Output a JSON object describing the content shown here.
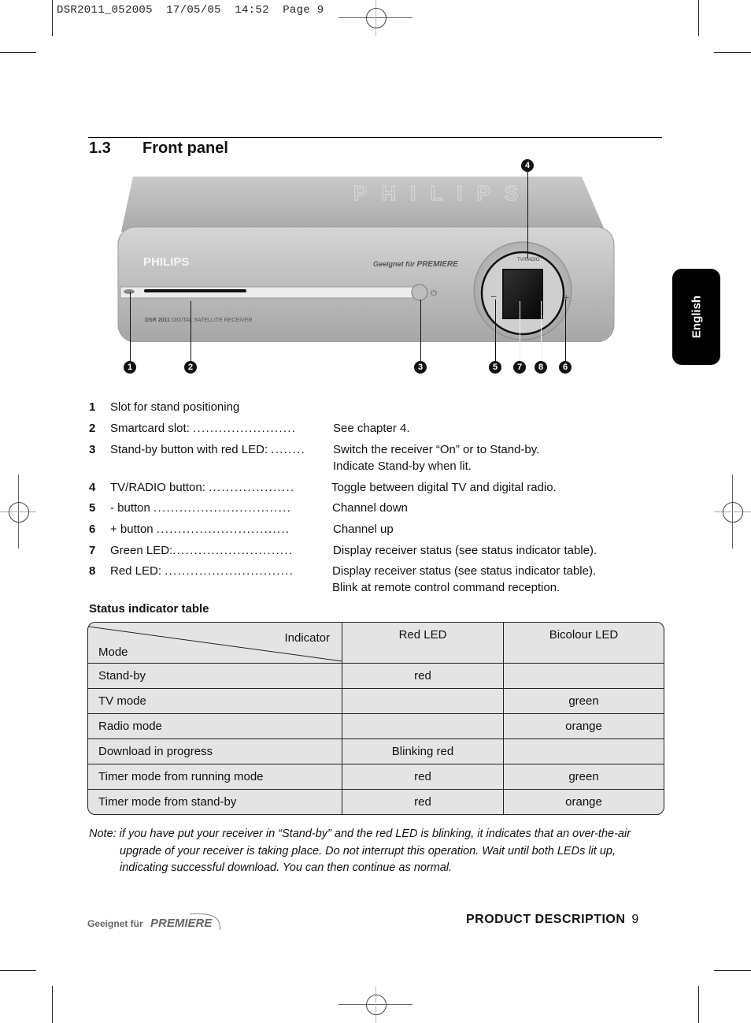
{
  "slug": {
    "file": "DSR2011_052005",
    "date": "17/05/05",
    "time": "14:52",
    "page_label": "Page",
    "page_num": "9"
  },
  "section": {
    "number": "1.3",
    "title": "Front panel"
  },
  "language_tab": "English",
  "device": {
    "brand": "PHILIPS",
    "badge_prefix": "Geeignet für",
    "badge_brand": "PREMIERE",
    "model": "DSR 2011",
    "model_desc": "DIGITAL SATELLITE RECEIVER",
    "tv_radio_label": "TV/RADIO",
    "minus_label": "−",
    "plus_label": "+",
    "callouts": [
      "1",
      "2",
      "3",
      "4",
      "5",
      "6",
      "7",
      "8"
    ]
  },
  "items": [
    {
      "num": "1",
      "label": "Slot for stand positioning",
      "leader": "",
      "desc": [
        ""
      ]
    },
    {
      "num": "2",
      "label": "Smartcard slot:",
      "leader": "........................",
      "desc": [
        "See chapter 4."
      ]
    },
    {
      "num": "3",
      "label": "Stand-by button with red LED:",
      "leader": "........",
      "desc": [
        "Switch the receiver “On” or to Stand-by.",
        "Indicate Stand-by when lit."
      ]
    },
    {
      "num": "4",
      "label": "TV/RADIO button:",
      "leader": "....................",
      "desc": [
        "Toggle between digital TV and digital radio."
      ]
    },
    {
      "num": "5",
      "label": "- button",
      "leader": "................................",
      "desc": [
        "Channel down"
      ]
    },
    {
      "num": "6",
      "label": "+ button",
      "leader": "...............................",
      "desc": [
        "Channel up"
      ]
    },
    {
      "num": "7",
      "label": "Green LED:",
      "leader": "............................",
      "desc": [
        "Display receiver status (see status indicator table)."
      ]
    },
    {
      "num": "8",
      "label": "Red LED:",
      "leader": "..............................",
      "desc": [
        "Display receiver status (see status indicator table).",
        "Blink at remote control command reception."
      ]
    }
  ],
  "status_table": {
    "title": "Status indicator table",
    "header": {
      "indicator": "Indicator",
      "mode": "Mode",
      "red_led": "Red LED",
      "bicolour_led": "Bicolour LED"
    },
    "rows": [
      {
        "mode": "Stand-by",
        "red": "red",
        "bicolour": ""
      },
      {
        "mode": "TV mode",
        "red": "",
        "bicolour": "green"
      },
      {
        "mode": "Radio mode",
        "red": "",
        "bicolour": "orange"
      },
      {
        "mode": "Download in progress",
        "red": "Blinking red",
        "bicolour": ""
      },
      {
        "mode": "Timer mode from running mode",
        "red": "red",
        "bicolour": "green"
      },
      {
        "mode": "Timer mode from stand-by",
        "red": "red",
        "bicolour": "orange"
      }
    ]
  },
  "note": {
    "line1": "Note: if you have put your receiver in “Stand-by” and the red LED is blinking, it indicates that an over-the-air",
    "line2": "upgrade of your receiver is taking place. Do not interrupt this operation. Wait until both LEDs lit up,",
    "line3": "indicating successful download. You can then continue as normal."
  },
  "footer": {
    "brand_prefix": "Geeignet für",
    "brand": "PREMIERE",
    "section_label": "PRODUCT DESCRIPTION",
    "page_number": "9"
  }
}
